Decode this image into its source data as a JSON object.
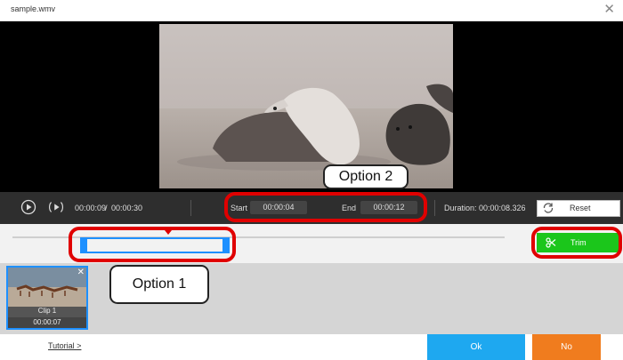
{
  "window": {
    "title": "sample.wmv",
    "close_symbol": "✕"
  },
  "annotations": {
    "option1": "Option 1",
    "option2": "Option 2",
    "highlight_color": "#e00000"
  },
  "controls": {
    "current_time": "00:00:09",
    "time_divider": "/",
    "total_time": "00:00:30",
    "start_label": "Start",
    "start_value": "00:00:04",
    "end_label": "End",
    "end_value": "00:00:12",
    "duration_label": "Duration:",
    "duration_value": "00:00:08.326",
    "reset_label": "Reset"
  },
  "timeline": {
    "trim_label": "Trim",
    "trim_color": "#1bc61b",
    "selection_color": "#1e90ff"
  },
  "clips": [
    {
      "label": "Clip 1",
      "duration": "00:00:07",
      "close_symbol": "✕"
    }
  ],
  "footer": {
    "tutorial_label": "Tutorial >",
    "ok_label": "Ok",
    "no_label": "No",
    "ok_color": "#1ea8f0",
    "no_color": "#f07c1e"
  }
}
